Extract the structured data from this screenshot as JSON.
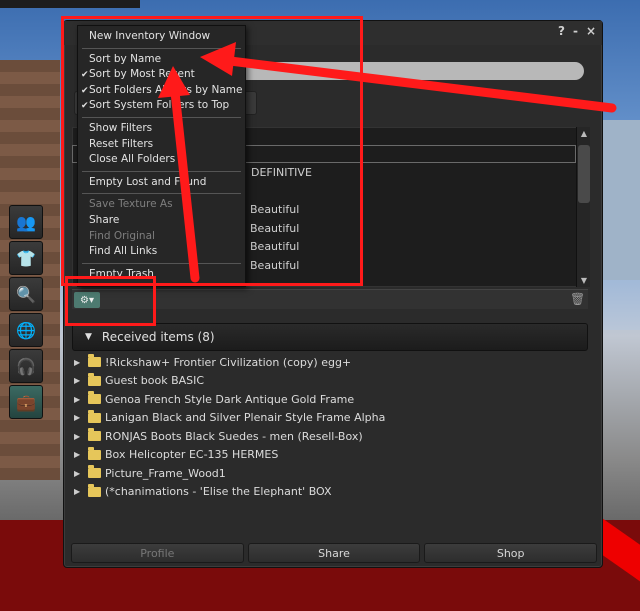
{
  "colors": {
    "annotation_red": "#ff1a1a",
    "folder": "#e6c65a",
    "panel": "#2b2b2b"
  },
  "window": {
    "title_buttons": [
      "?",
      "-",
      "×"
    ],
    "tree_items": [
      "DEFINITIVE",
      "Beautiful",
      "Beautiful",
      "Beautiful",
      "Beautiful"
    ],
    "received": {
      "label": "Received items (8)"
    },
    "items": [
      "!Rickshaw+ Frontier Civilization (copy) egg+",
      "Guest book BASIC",
      "Genoa French Style Dark Antique Gold Frame",
      "Lanigan Black and Silver Plenair Style Frame Alpha",
      "RONJAS Boots Black Suedes - men (Resell-Box)",
      "Box Helicopter EC-135 HERMES",
      "Picture_Frame_Wood1",
      "(*chanimations - 'Elise the Elephant' BOX"
    ],
    "buttons": {
      "profile": "Profile",
      "share": "Share",
      "shop": "Shop"
    }
  },
  "menu": {
    "groups": [
      [
        {
          "label": "New Inventory Window",
          "checked": false,
          "disabled": false
        }
      ],
      [
        {
          "label": "Sort by Name",
          "checked": false,
          "disabled": false
        },
        {
          "label": "Sort by Most Recent",
          "checked": true,
          "disabled": false
        },
        {
          "label": "Sort Folders Always by Name",
          "checked": true,
          "disabled": false
        },
        {
          "label": "Sort System Folders to Top",
          "checked": true,
          "disabled": false
        }
      ],
      [
        {
          "label": "Show Filters",
          "checked": false,
          "disabled": false
        },
        {
          "label": "Reset Filters",
          "checked": false,
          "disabled": false
        },
        {
          "label": "Close All Folders",
          "checked": false,
          "disabled": false
        }
      ],
      [
        {
          "label": "Empty Lost and Found",
          "checked": false,
          "disabled": false
        }
      ],
      [
        {
          "label": "Save Texture As",
          "checked": false,
          "disabled": true
        },
        {
          "label": "Share",
          "checked": false,
          "disabled": false
        },
        {
          "label": "Find Original",
          "checked": false,
          "disabled": true
        },
        {
          "label": "Find All Links",
          "checked": false,
          "disabled": false
        }
      ],
      [
        {
          "label": "Empty Trash",
          "checked": false,
          "disabled": false
        }
      ]
    ]
  },
  "toolbar": {
    "icons": [
      "people-icon",
      "shirt-icon",
      "search-icon",
      "globe-icon",
      "headphones-icon",
      "inventory-icon"
    ]
  }
}
